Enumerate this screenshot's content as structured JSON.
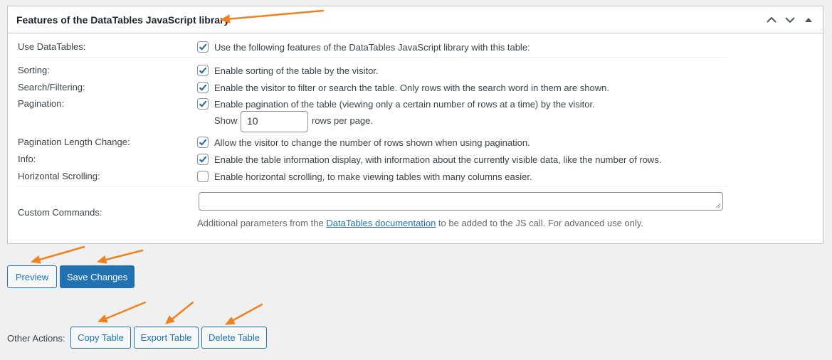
{
  "panel": {
    "title": "Features of the DataTables JavaScript library",
    "controls": {
      "up": "move-up",
      "down": "move-down",
      "toggle": "collapse"
    }
  },
  "options": {
    "use_datatables": {
      "label": "Use DataTables:",
      "checked": true,
      "text": "Use the following features of the DataTables JavaScript library with this table:"
    },
    "sorting": {
      "label": "Sorting:",
      "checked": true,
      "text": "Enable sorting of the table by the visitor."
    },
    "search": {
      "label": "Search/Filtering:",
      "checked": true,
      "text": "Enable the visitor to filter or search the table. Only rows with the search word in them are shown."
    },
    "pagination": {
      "label": "Pagination:",
      "checked": true,
      "text": "Enable pagination of the table (viewing only a certain number of rows at a time) by the visitor.",
      "show_label": "Show",
      "rows_value": "10",
      "rows_suffix": "rows per page."
    },
    "length_change": {
      "label": "Pagination Length Change:",
      "checked": true,
      "text": "Allow the visitor to change the number of rows shown when using pagination."
    },
    "info": {
      "label": "Info:",
      "checked": true,
      "text": "Enable the table information display, with information about the currently visible data, like the number of rows."
    },
    "horizontal_scroll": {
      "label": "Horizontal Scrolling:",
      "checked": false,
      "text": "Enable horizontal scrolling, to make viewing tables with many columns easier."
    },
    "custom_commands": {
      "label": "Custom Commands:",
      "value": "",
      "help_prefix": "Additional parameters from the ",
      "help_link": "DataTables documentation",
      "help_suffix": " to be added to the JS call. For advanced use only."
    }
  },
  "buttons": {
    "preview": "Preview",
    "save": "Save Changes"
  },
  "other_actions": {
    "label": "Other Actions:",
    "copy": "Copy Table",
    "export": "Export Table",
    "delete": "Delete Table"
  },
  "colors": {
    "accent": "#2271b1",
    "annotation_arrow": "#f0821e",
    "checkbox_check": "#2271b1"
  }
}
